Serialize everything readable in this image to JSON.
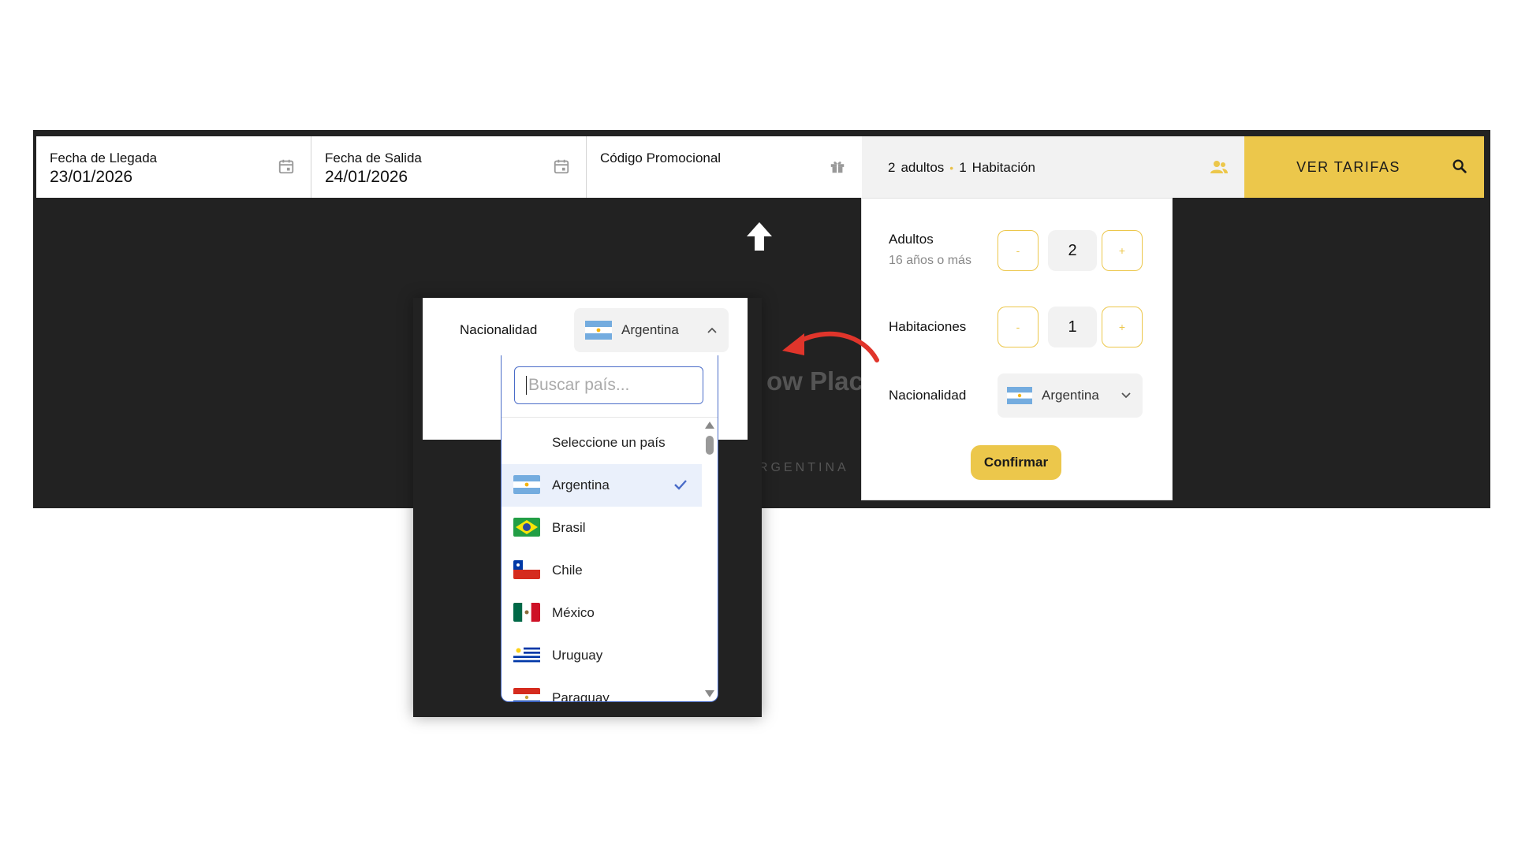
{
  "search_bar": {
    "arrival": {
      "label": "Fecha de Llegada",
      "value": "23/01/2026",
      "icon": "calendar-icon"
    },
    "departure": {
      "label": "Fecha de Salida",
      "value": "24/01/2026",
      "icon": "calendar-icon"
    },
    "promo": {
      "label": "Código Promocional",
      "icon": "gift-icon"
    },
    "guests": {
      "adults_count": "2",
      "adults_label": "adultos",
      "separator": "•",
      "rooms_count": "1",
      "rooms_label": "Habitación",
      "icon": "users-icon"
    },
    "cta": {
      "label": "VER TARIFAS",
      "icon": "search-icon"
    }
  },
  "guests_panel": {
    "adults": {
      "label": "Adultos",
      "sublabel": "16 años o más",
      "minus": "-",
      "value": "2",
      "plus": "+"
    },
    "rooms": {
      "label": "Habitaciones",
      "minus": "-",
      "value": "1",
      "plus": "+"
    },
    "nationality": {
      "label": "Nacionalidad",
      "value": "Argentina"
    },
    "confirm_label": "Confirmar"
  },
  "background_text": {
    "title_fragment": "ow Place",
    "subtitle_fragment": "RGENTINA"
  },
  "zoom_inset": {
    "nationality_label": "Nacionalidad",
    "selected": "Argentina",
    "search_placeholder": "Buscar país...",
    "options": [
      {
        "label": "Seleccione un país",
        "flag": null
      },
      {
        "label": "Argentina",
        "flag": "argentina",
        "selected": true
      },
      {
        "label": "Brasil",
        "flag": "brasil"
      },
      {
        "label": "Chile",
        "flag": "chile"
      },
      {
        "label": "México",
        "flag": "mexico"
      },
      {
        "label": "Uruguay",
        "flag": "uruguay"
      },
      {
        "label": "Paraguay",
        "flag": "paraguay"
      }
    ]
  },
  "colors": {
    "accent": "#ecc74b",
    "focus": "#4a6cc8",
    "dark_bg": "#222222",
    "annotation": "#e0352b"
  }
}
